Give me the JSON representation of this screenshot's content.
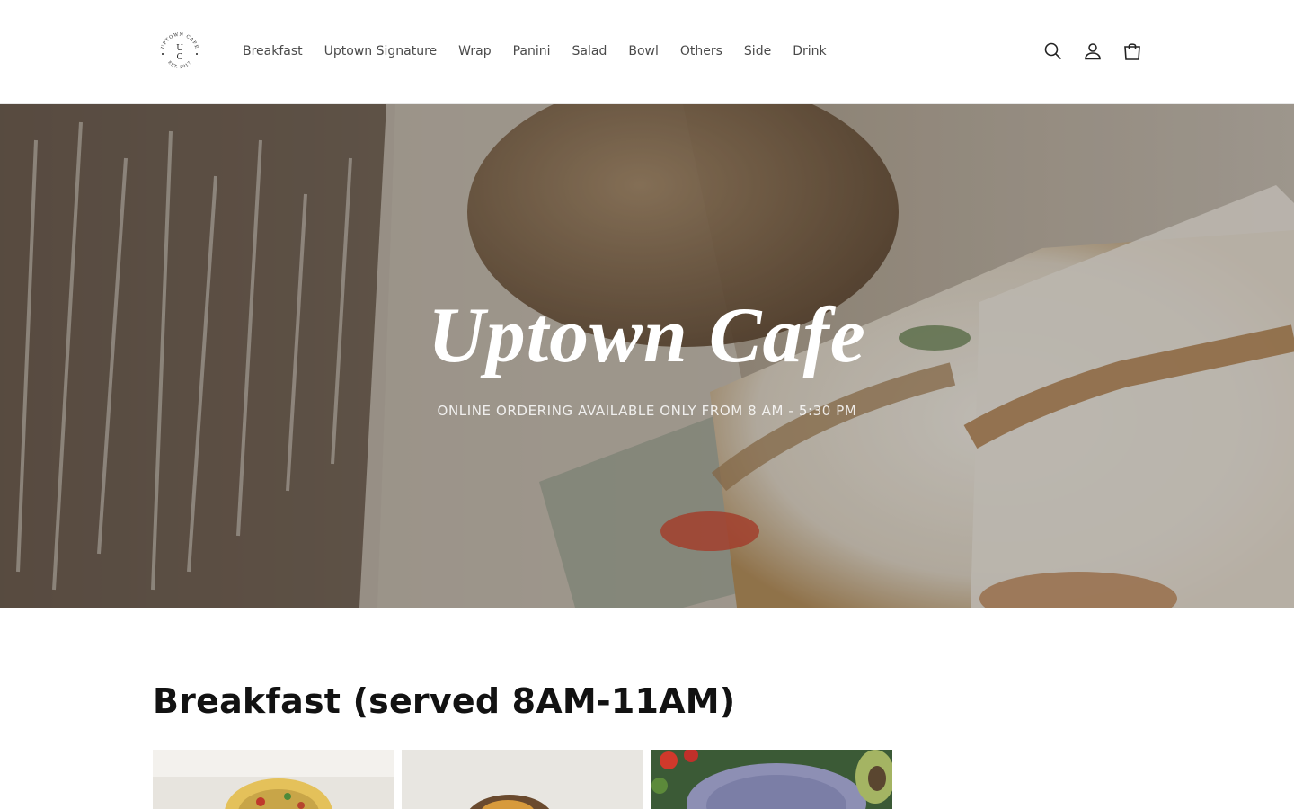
{
  "header": {
    "logo": {
      "top_text": "UPTOWN CAFE",
      "monogram_top": "U",
      "monogram_bottom": "C",
      "bottom_text": "EST. 2017"
    },
    "nav": [
      {
        "label": "Breakfast"
      },
      {
        "label": "Uptown Signature"
      },
      {
        "label": "Wrap"
      },
      {
        "label": "Panini"
      },
      {
        "label": "Salad"
      },
      {
        "label": "Bowl"
      },
      {
        "label": "Others"
      },
      {
        "label": "Side"
      },
      {
        "label": "Drink"
      }
    ],
    "icons": [
      "search-icon",
      "account-icon",
      "cart-icon"
    ]
  },
  "hero": {
    "title": "Uptown Cafe",
    "subtitle": "ONLINE ORDERING AVAILABLE ONLY FROM 8 AM - 5:30 PM"
  },
  "collection": {
    "title": "Breakfast (served 8AM-11AM)"
  },
  "colors": {
    "text": "#121212",
    "nav_text": "#4a4a4a",
    "background": "#ffffff"
  }
}
